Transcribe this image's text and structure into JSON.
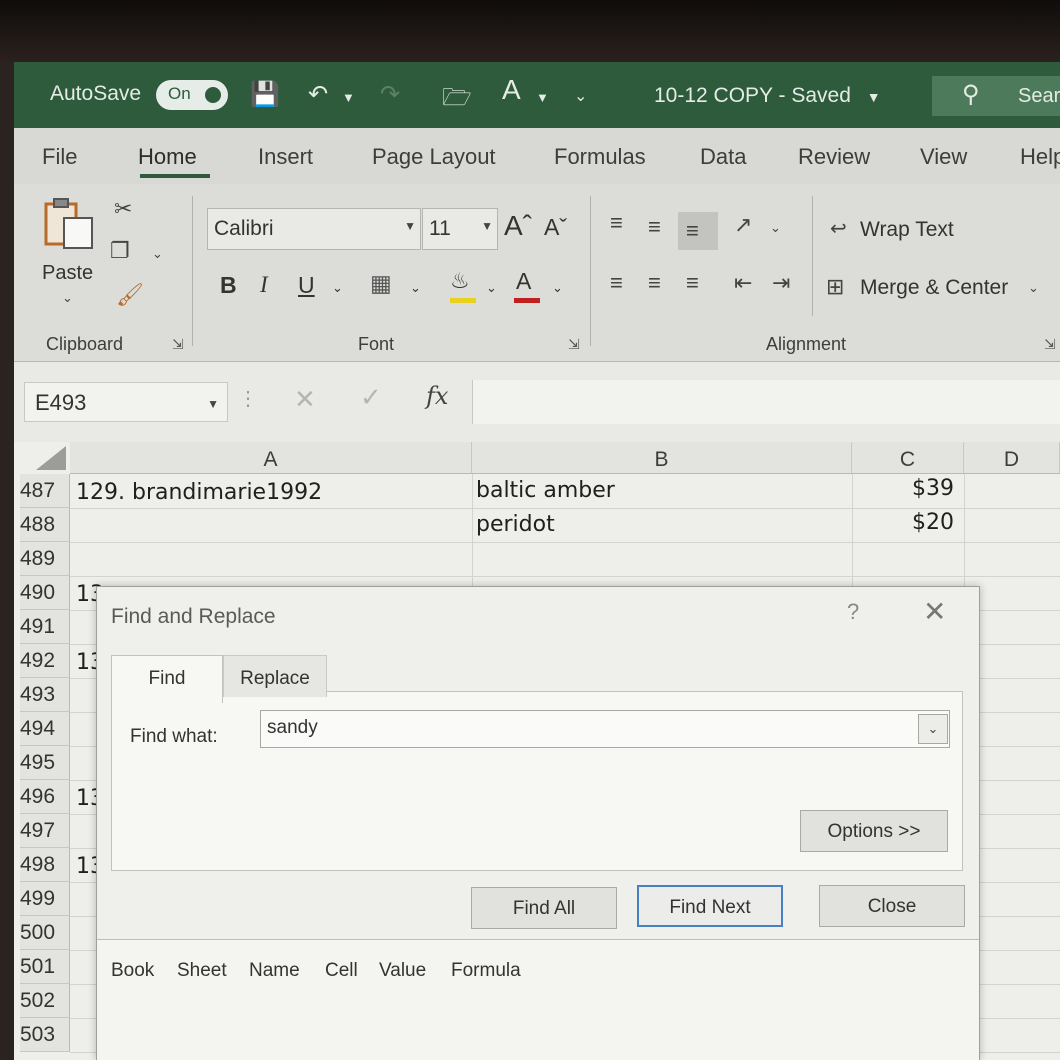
{
  "titlebar": {
    "autosave_label": "AutoSave",
    "autosave_state": "On",
    "document_title": "10-12 COPY",
    "save_status": "Saved",
    "search_label": "Sear"
  },
  "ribbon_tabs": [
    "File",
    "Home",
    "Insert",
    "Page Layout",
    "Formulas",
    "Data",
    "Review",
    "View",
    "Help"
  ],
  "clipboard": {
    "paste_label": "Paste",
    "group_label": "Clipboard"
  },
  "font": {
    "font_name": "Calibri",
    "font_size": "11",
    "bold": "B",
    "italic": "I",
    "underline": "U",
    "group_label": "Font",
    "fill_color": "#e8d21f",
    "font_color": "#c0201f"
  },
  "alignment": {
    "wrap_text": "Wrap Text",
    "merge_center": "Merge & Center",
    "group_label": "Alignment"
  },
  "formula_bar": {
    "name_box": "E493",
    "fx": "fx"
  },
  "grid": {
    "columns": [
      "A",
      "B",
      "C",
      "D"
    ],
    "rows": [
      "487",
      "488",
      "489",
      "490",
      "491",
      "492",
      "493",
      "494",
      "495",
      "496",
      "497",
      "498",
      "499",
      "500",
      "501",
      "502",
      "503"
    ],
    "cells": {
      "r487_a": "129. brandimarie1992",
      "r487_b": "baltic amber",
      "r487_c": "$39",
      "r488_b": "peridot",
      "r488_c": "$20"
    },
    "partial_a": {
      "r490": "13",
      "r492": "13",
      "r496": "13",
      "r498": "13"
    }
  },
  "dialog": {
    "title": "Find and Replace",
    "help": "?",
    "tab_find": "Find",
    "tab_replace": "Replace",
    "find_what_label": "Find what:",
    "find_what_value": "sandy",
    "options_button": "Options >>",
    "find_all_button": "Find All",
    "find_next_button": "Find Next",
    "close_button": "Close",
    "result_columns": [
      "Book",
      "Sheet",
      "Name",
      "Cell",
      "Value",
      "Formula"
    ]
  },
  "colors": {
    "title_green": "#2e5b3c",
    "accent_blue": "#4b7fc4"
  }
}
